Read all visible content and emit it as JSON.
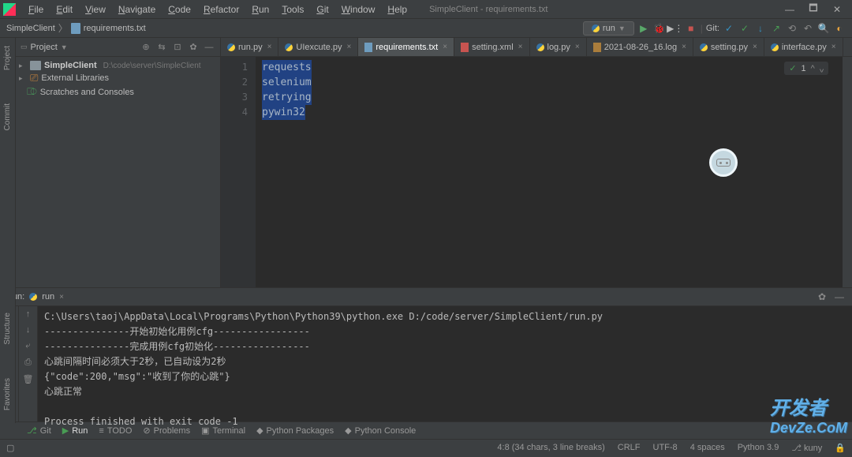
{
  "window": {
    "title": "SimpleClient - requirements.txt",
    "menu": [
      "File",
      "Edit",
      "View",
      "Navigate",
      "Code",
      "Refactor",
      "Run",
      "Tools",
      "Git",
      "Window",
      "Help"
    ]
  },
  "breadcrumb": {
    "root": "SimpleClient",
    "file": "requirements.txt"
  },
  "run_config": {
    "selected": "run",
    "git_label": "Git:"
  },
  "left_rail": {
    "project": "Project",
    "commit": "Commit",
    "structure": "Structure",
    "favorites": "Favorites"
  },
  "project_panel": {
    "title": "Project",
    "root": {
      "name": "SimpleClient",
      "path": "D:\\code\\server\\SimpleClient"
    },
    "external_libs": "External Libraries",
    "scratches": "Scratches and Consoles"
  },
  "tabs": [
    {
      "icon": "py",
      "label": "run.py",
      "active": false
    },
    {
      "icon": "py",
      "label": "UIexcute.py",
      "active": false
    },
    {
      "icon": "txt",
      "label": "requirements.txt",
      "active": true
    },
    {
      "icon": "xml",
      "label": "setting.xml",
      "active": false
    },
    {
      "icon": "py",
      "label": "log.py",
      "active": false
    },
    {
      "icon": "log",
      "label": "2021-08-26_16.log",
      "active": false
    },
    {
      "icon": "py",
      "label": "setting.py",
      "active": false
    },
    {
      "icon": "py",
      "label": "interface.py",
      "active": false
    }
  ],
  "editor": {
    "lines": [
      "requests",
      "selenium",
      "retrying",
      "pywin32"
    ],
    "inspection": {
      "count": "1",
      "caret": "^"
    }
  },
  "run_panel": {
    "label": "Run:",
    "tab": "run",
    "output": "C:\\Users\\taoj\\AppData\\Local\\Programs\\Python\\Python39\\python.exe D:/code/server/SimpleClient/run.py\n---------------开始初始化用例cfg-----------------\n---------------完成用例cfg初始化-----------------\n心跳间隔时间必须大于2秒，已自动设为2秒\n{\"code\":200,\"msg\":\"收到了你的心跳\"}\n心跳正常\n\nProcess finished with exit code -1"
  },
  "bottom_bar": {
    "git": "Git",
    "run": "Run",
    "todo": "TODO",
    "problems": "Problems",
    "terminal": "Terminal",
    "pypkg": "Python Packages",
    "pyconsole": "Python Console"
  },
  "status_bar": {
    "pos": "4:8 (34 chars, 3 line breaks)",
    "le": "CRLF",
    "enc": "UTF-8",
    "indent": "4 spaces",
    "python": "Python 3.9",
    "branch": "kuny"
  },
  "watermark": {
    "line1": "开发者",
    "line2": "DevZe.CoM"
  }
}
